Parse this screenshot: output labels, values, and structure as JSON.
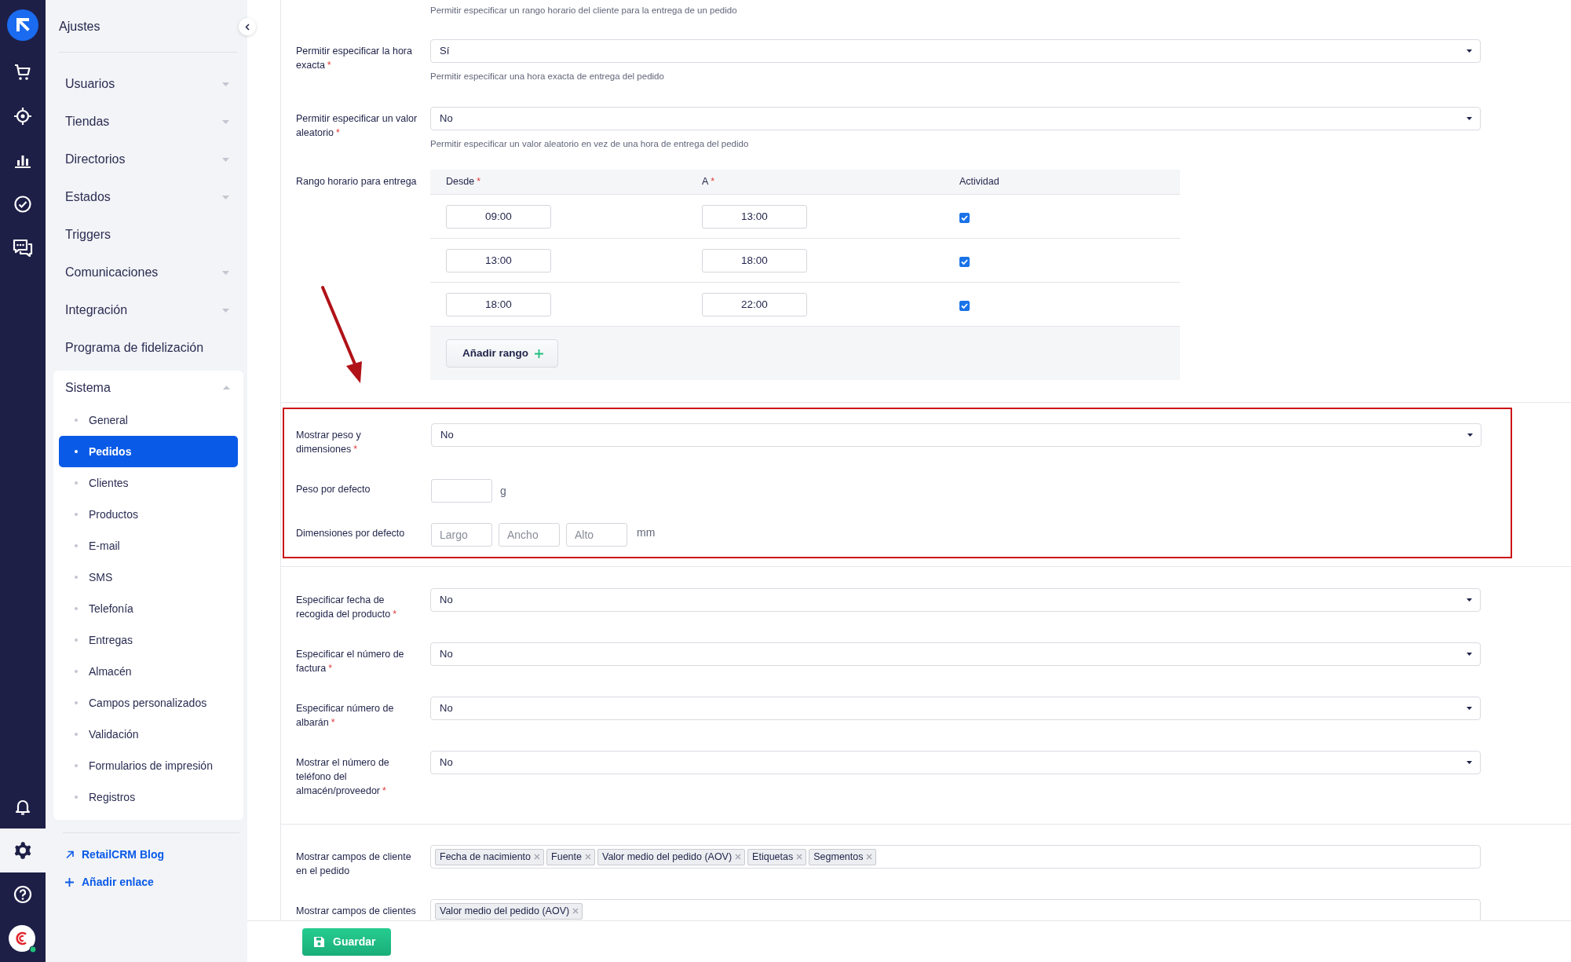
{
  "rail": {
    "top": [
      {
        "kind": "logo",
        "selected": false
      },
      {
        "kind": "cart",
        "selected": false
      },
      {
        "kind": "target",
        "selected": false
      },
      {
        "kind": "chart",
        "selected": false
      },
      {
        "kind": "check",
        "selected": false
      },
      {
        "kind": "chat",
        "selected": false
      }
    ],
    "bottom": [
      {
        "kind": "bell",
        "selected": false
      },
      {
        "kind": "gear",
        "selected": true
      },
      {
        "kind": "help",
        "selected": false
      },
      {
        "kind": "avatar",
        "selected": false
      }
    ]
  },
  "sidebar": {
    "title": "Ajustes",
    "items": [
      {
        "label": "Usuarios",
        "has_submenu": true,
        "expanded": false
      },
      {
        "label": "Tiendas",
        "has_submenu": true,
        "expanded": false
      },
      {
        "label": "Directorios",
        "has_submenu": true,
        "expanded": false
      },
      {
        "label": "Estados",
        "has_submenu": true,
        "expanded": false
      },
      {
        "label": "Triggers",
        "has_submenu": false,
        "expanded": false
      },
      {
        "label": "Comunicaciones",
        "has_submenu": true,
        "expanded": false
      },
      {
        "label": "Integración",
        "has_submenu": true,
        "expanded": false
      },
      {
        "label": "Programa de fidelización",
        "has_submenu": false,
        "expanded": false
      },
      {
        "label": "Sistema",
        "has_submenu": true,
        "expanded": true,
        "children": [
          {
            "label": "General",
            "selected": false
          },
          {
            "label": "Pedidos",
            "selected": true
          },
          {
            "label": "Clientes",
            "selected": false
          },
          {
            "label": "Productos",
            "selected": false
          },
          {
            "label": "E-mail",
            "selected": false
          },
          {
            "label": "SMS",
            "selected": false
          },
          {
            "label": "Telefonía",
            "selected": false
          },
          {
            "label": "Entregas",
            "selected": false
          },
          {
            "label": "Almacén",
            "selected": false
          },
          {
            "label": "Campos personalizados",
            "selected": false
          },
          {
            "label": "Validación",
            "selected": false
          },
          {
            "label": "Formularios de impresión",
            "selected": false
          },
          {
            "label": "Registros",
            "selected": false
          }
        ]
      }
    ],
    "links": [
      {
        "kind": "external",
        "label": "RetailCRM Blog"
      },
      {
        "kind": "add",
        "label": "Añadir enlace"
      }
    ]
  },
  "sections": [
    {
      "highlighted": false,
      "fields": [
        {
          "kind": "hint",
          "text": "Permitir especificar un rango horario del cliente para la entrega de un pedido"
        },
        {
          "kind": "select",
          "label": "Permitir especificar la hora exacta",
          "mark": "*",
          "value": "Sí",
          "hint": "Permitir especificar una hora exacta de entrega del pedido"
        },
        {
          "kind": "select",
          "label": "Permitir especificar un valor aleatorio",
          "mark": "*",
          "value": "No",
          "hint": "Permitir especificar un valor aleatorio en vez de una hora de entrega del pedido"
        },
        {
          "kind": "time_ranges",
          "label": "Rango horario para entrega",
          "columns": [
            {
              "label": "Desde",
              "mark": "*"
            },
            {
              "label": "A",
              "mark": "*"
            },
            {
              "label": "Actividad"
            }
          ],
          "rows": [
            {
              "from": "09:00",
              "to": "13:00",
              "active": true
            },
            {
              "from": "13:00",
              "to": "18:00",
              "active": true
            },
            {
              "from": "18:00",
              "to": "22:00",
              "active": true
            }
          ],
          "add_button": "Añadir rango"
        }
      ]
    },
    {
      "highlighted": true,
      "fields": [
        {
          "kind": "select",
          "label": "Mostrar peso y dimensiones",
          "mark": "*",
          "value": "No"
        },
        {
          "kind": "weight",
          "label": "Peso por defecto",
          "unit": "g"
        },
        {
          "kind": "dimensions",
          "label": "Dimensiones por defecto",
          "placeholders": [
            "Largo",
            "Ancho",
            "Alto"
          ],
          "unit": "mm"
        }
      ]
    },
    {
      "highlighted": false,
      "fields": [
        {
          "kind": "select",
          "label": "Especificar fecha de recogida del producto",
          "mark": "*",
          "value": "No"
        },
        {
          "kind": "select",
          "label": "Especificar el número de factura",
          "mark": "*",
          "value": "No"
        },
        {
          "kind": "select",
          "label": "Especificar número de albarán",
          "mark": "*",
          "value": "No"
        },
        {
          "kind": "select",
          "label": "Mostrar el número de teléfono del almacén/proveedor",
          "mark": "*",
          "value": "No"
        }
      ]
    },
    {
      "highlighted": false,
      "fields": [
        {
          "kind": "tags",
          "label": "Mostrar campos de cliente en el pedido",
          "tags": [
            "Fecha de nacimiento",
            "Fuente",
            "Valor medio del pedido (AOV)",
            "Etiquetas",
            "Segmentos"
          ]
        },
        {
          "kind": "tags",
          "label": "Mostrar campos de clientes",
          "tags": [
            "Valor medio del pedido (AOV)"
          ]
        }
      ]
    }
  ],
  "save_button": "Guardar"
}
